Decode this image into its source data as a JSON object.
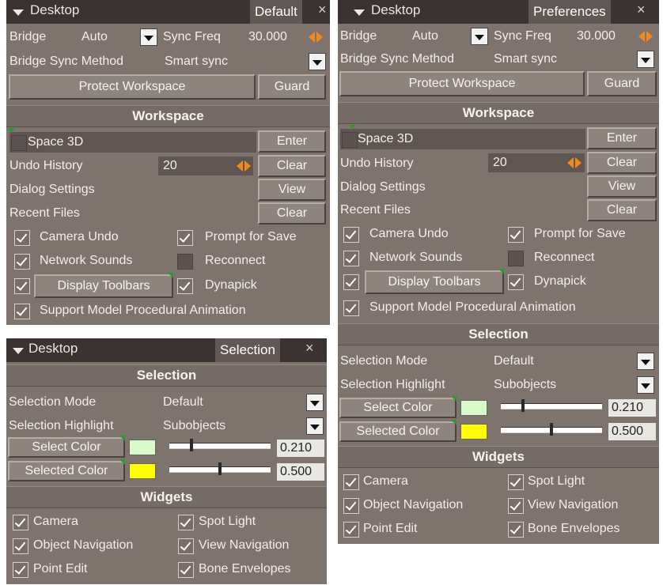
{
  "panels": {
    "default": {
      "title": "Desktop",
      "tab": "Default",
      "close": "×",
      "bridge_label": "Bridge",
      "bridge_value": "Auto",
      "sync_freq_label": "Sync Freq",
      "sync_freq_value": "30.000",
      "bridge_sync_method_label": "Bridge Sync Method",
      "bridge_sync_method_value": "Smart sync",
      "protect_workspace": "Protect Workspace",
      "guard": "Guard",
      "workspace_header": "Workspace",
      "space3d": "Space 3D",
      "enter": "Enter",
      "undo_history_label": "Undo History",
      "undo_history_value": "20",
      "clear": "Clear",
      "dialog_settings": "Dialog Settings",
      "view": "View",
      "recent_files": "Recent Files",
      "clear2": "Clear",
      "camera_undo": "Camera Undo",
      "prompt_for_save": "Prompt for Save",
      "network_sounds": "Network Sounds",
      "reconnect": "Reconnect",
      "display_toolbars": "Display Toolbars",
      "dynapick": "Dynapick",
      "support_model": "Support Model Procedural Animation"
    },
    "preferences": {
      "title": "Desktop",
      "tab": "Preferences",
      "close": "×",
      "bridge_label": "Bridge",
      "bridge_value": "Auto",
      "sync_freq_label": "Sync Freq",
      "sync_freq_value": "30.000",
      "bridge_sync_method_label": "Bridge Sync Method",
      "bridge_sync_method_value": "Smart sync",
      "protect_workspace": "Protect Workspace",
      "guard": "Guard",
      "workspace_header": "Workspace",
      "space3d": "Space 3D",
      "enter": "Enter",
      "undo_history_label": "Undo History",
      "undo_history_value": "20",
      "clear": "Clear",
      "dialog_settings": "Dialog Settings",
      "view": "View",
      "recent_files": "Recent Files",
      "clear2": "Clear",
      "camera_undo": "Camera Undo",
      "prompt_for_save": "Prompt for Save",
      "network_sounds": "Network Sounds",
      "reconnect": "Reconnect",
      "display_toolbars": "Display Toolbars",
      "dynapick": "Dynapick",
      "support_model": "Support Model Procedural Animation",
      "selection_header": "Selection",
      "selection_mode_label": "Selection Mode",
      "selection_mode_value": "Default",
      "selection_highlight_label": "Selection Highlight",
      "selection_highlight_value": "Subobjects",
      "select_color_label": "Select Color",
      "select_color_value": "0.210",
      "select_color_level": 0.21,
      "selected_color_label": "Selected Color",
      "selected_color_value": "0.500",
      "selected_color_level": 0.5,
      "widgets_header": "Widgets",
      "camera": "Camera",
      "spot_light": "Spot Light",
      "object_navigation": "Object Navigation",
      "view_navigation": "View Navigation",
      "point_edit": "Point Edit",
      "bone_envelopes": "Bone Envelopes"
    },
    "selection": {
      "title": "Desktop",
      "tab": "Selection",
      "close": "×",
      "selection_header": "Selection",
      "selection_mode_label": "Selection Mode",
      "selection_mode_value": "Default",
      "selection_highlight_label": "Selection Highlight",
      "selection_highlight_value": "Subobjects",
      "select_color_label": "Select Color",
      "select_color_value": "0.210",
      "select_color_level": 0.21,
      "selected_color_label": "Selected Color",
      "selected_color_value": "0.500",
      "selected_color_level": 0.5,
      "widgets_header": "Widgets",
      "camera": "Camera",
      "spot_light": "Spot Light",
      "object_navigation": "Object Navigation",
      "view_navigation": "View Navigation",
      "point_edit": "Point Edit",
      "bone_envelopes": "Bone Envelopes"
    }
  },
  "colors": {
    "select_color": "#d9fbc9",
    "selected_color": "#ffff00",
    "spinner_accent": "#f08a1c"
  }
}
